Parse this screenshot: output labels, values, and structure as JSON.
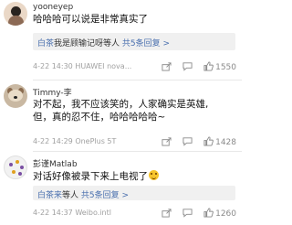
{
  "comments": [
    {
      "username": "yooneyep",
      "text": "哈哈哈可以说是非常真实了",
      "reply": {
        "user": "白茶",
        "text": "我是顾输记呀等人",
        "count": "共5条回复 >"
      },
      "time": "4-22 14:30",
      "device": "HUAWEI nova...",
      "likes": "1550"
    },
    {
      "username": "Timmy-李",
      "lines": [
        "对不起，我不应该笑的，人家确实是英雄,",
        "但，真的忍不住，哈哈哈哈哈~"
      ],
      "time": "4-22 14:29",
      "device": "OnePlus 5T",
      "likes": "1428"
    },
    {
      "username": "彭谨Matlab",
      "text": "对话好像被录下来上电视了",
      "emoji": "laughing-emoji",
      "reply": {
        "user": "白茶来",
        "text": "等人",
        "count": "共5条回复 >"
      },
      "time": "4-22 14:37",
      "device": "Weibo.intl",
      "likes": "1260"
    }
  ],
  "icons": {
    "share": "share-icon",
    "reply": "comment-icon",
    "like": "thumbs-up-icon"
  },
  "colors": {
    "link": "#496fae",
    "meta": "#a0a0a0",
    "reply_bg": "#f0f0f0"
  }
}
